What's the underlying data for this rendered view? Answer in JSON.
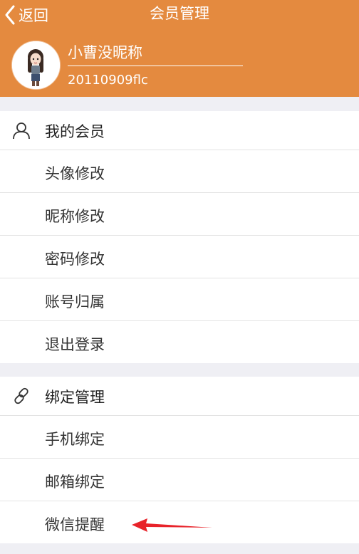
{
  "navbar": {
    "back_label": "返回",
    "title": "会员管理"
  },
  "profile": {
    "nickname": "小曹没昵称",
    "account": "20110909flc"
  },
  "member_section": {
    "title": "我的会员",
    "icon": "user-icon",
    "items": [
      "头像修改",
      "昵称修改",
      "密码修改",
      "账号归属",
      "退出登录"
    ]
  },
  "binding_section": {
    "title": "绑定管理",
    "icon": "link-icon",
    "items": [
      "手机绑定",
      "邮箱绑定",
      "微信提醒"
    ]
  },
  "colors": {
    "accent": "#e48a3f",
    "annotation_arrow": "#e8232a"
  }
}
